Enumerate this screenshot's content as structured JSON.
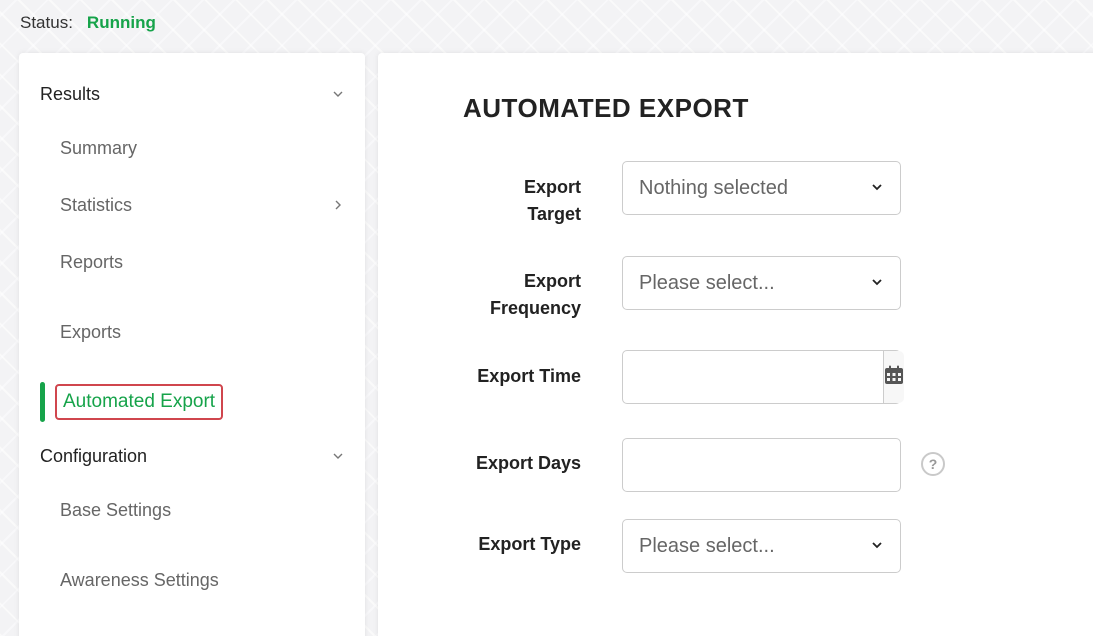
{
  "status": {
    "label": "Status:",
    "value": "Running",
    "value_color": "#16a34a"
  },
  "sidebar": {
    "sections": [
      {
        "label": "Results",
        "chevron": "chevron-down-icon"
      },
      {
        "label": "Configuration",
        "chevron": "chevron-down-icon"
      }
    ],
    "items": [
      {
        "label": "Summary"
      },
      {
        "label": "Statistics",
        "chevron": "chevron-right-icon"
      },
      {
        "label": "Reports"
      },
      {
        "label": "Exports"
      },
      {
        "label": "Automated Export",
        "active": true
      },
      {
        "label": "Base Settings"
      },
      {
        "label": "Awareness Settings"
      }
    ]
  },
  "main": {
    "title": "AUTOMATED EXPORT",
    "fields": {
      "target": {
        "label_line1": "Export",
        "label_line2": "Target",
        "value": "Nothing selected"
      },
      "frequency": {
        "label_line1": "Export",
        "label_line2": "Frequency",
        "value": "Please select..."
      },
      "time": {
        "label": "Export Time",
        "value": "",
        "icon": "calendar-icon"
      },
      "days": {
        "label": "Export Days",
        "value": "",
        "help": "?"
      },
      "type": {
        "label": "Export Type",
        "value": "Please select..."
      }
    }
  },
  "colors": {
    "accent": "#16a34a",
    "highlight_border": "#d0464e"
  }
}
